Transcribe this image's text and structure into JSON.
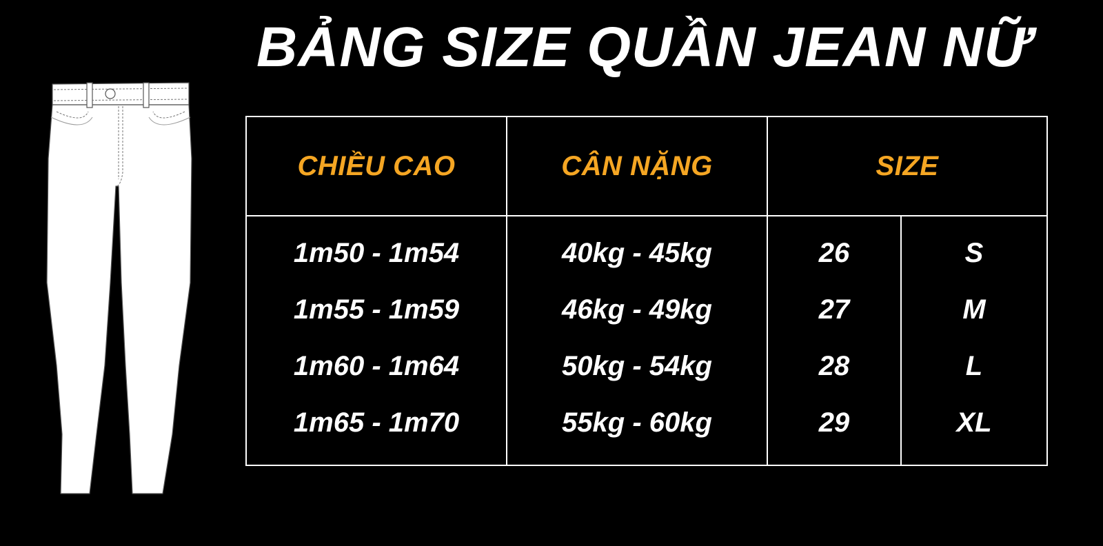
{
  "title": "BẢNG SIZE QUẦN JEAN NỮ",
  "colors": {
    "background": "#000000",
    "header_text": "#f5a623",
    "body_text": "#ffffff",
    "border": "#ffffff"
  },
  "illustration": {
    "icon": "jeans-icon"
  },
  "table": {
    "headers": {
      "height": "CHIỀU CAO",
      "weight": "CÂN NẶNG",
      "size": "SIZE"
    },
    "rows": [
      {
        "height": "1m50 - 1m54",
        "weight": "40kg - 45kg",
        "number": "26",
        "letter": "S"
      },
      {
        "height": "1m55 - 1m59",
        "weight": "46kg - 49kg",
        "number": "27",
        "letter": "M"
      },
      {
        "height": "1m60 - 1m64",
        "weight": "50kg - 54kg",
        "number": "28",
        "letter": "L"
      },
      {
        "height": "1m65 - 1m70",
        "weight": "55kg - 60kg",
        "number": "29",
        "letter": "XL"
      }
    ]
  }
}
